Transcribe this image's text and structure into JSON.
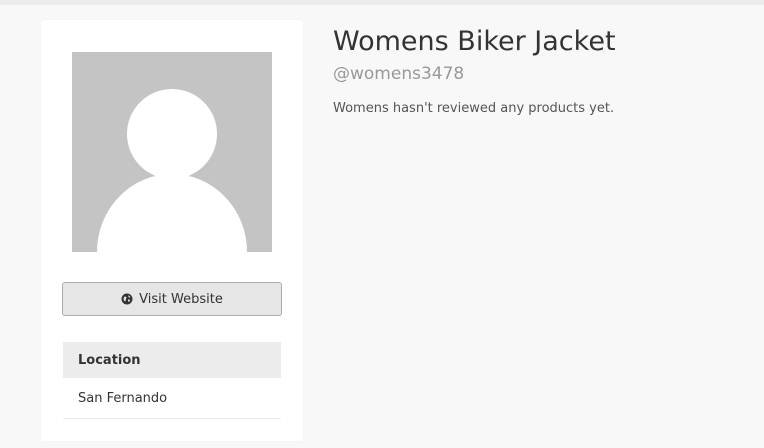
{
  "profile": {
    "name": "Womens Biker Jacket",
    "handle": "@womens3478",
    "reviews_message": "Womens hasn't reviewed any products yet.",
    "avatar_icon": "default-avatar-placeholder"
  },
  "actions": {
    "visit_website_label": "Visit Website",
    "visit_website_icon": "globe-icon"
  },
  "details": {
    "location_heading": "Location",
    "location_value": "San Fernando"
  },
  "colors": {
    "background": "#f8f8f8",
    "card": "#ffffff",
    "avatar_placeholder": "#c4c4c4",
    "button_bg": "#e6e6e6",
    "muted_text": "#999999"
  }
}
